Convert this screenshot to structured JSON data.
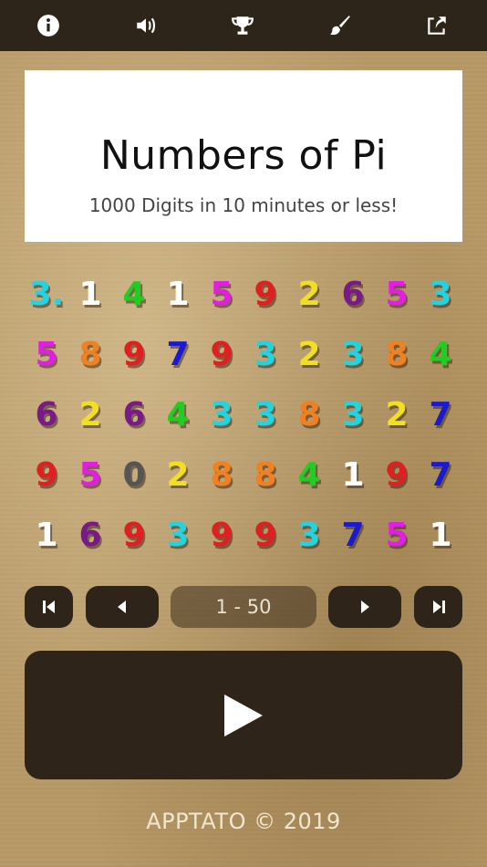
{
  "toolbar": {
    "icons": [
      "info-icon",
      "volume-icon",
      "trophy-icon",
      "brush-icon",
      "share-icon"
    ]
  },
  "header": {
    "title": "Numbers of Pi",
    "subtitle": "1000 Digits in 10 minutes or less!"
  },
  "digits": [
    {
      "text": "3.",
      "color": "#22d3e0"
    },
    {
      "text": "1",
      "color": "#ffffff"
    },
    {
      "text": "4",
      "color": "#22cc22"
    },
    {
      "text": "1",
      "color": "#ffffff"
    },
    {
      "text": "5",
      "color": "#e020e0"
    },
    {
      "text": "9",
      "color": "#e02020"
    },
    {
      "text": "2",
      "color": "#f0e020"
    },
    {
      "text": "6",
      "color": "#7a1a8a"
    },
    {
      "text": "5",
      "color": "#e020e0"
    },
    {
      "text": "3",
      "color": "#22d3e0"
    },
    {
      "text": "5",
      "color": "#e020e0"
    },
    {
      "text": "8",
      "color": "#f08020"
    },
    {
      "text": "9",
      "color": "#e02020"
    },
    {
      "text": "7",
      "color": "#1a1ad0"
    },
    {
      "text": "9",
      "color": "#e02020"
    },
    {
      "text": "3",
      "color": "#22d3e0"
    },
    {
      "text": "2",
      "color": "#f0e020"
    },
    {
      "text": "3",
      "color": "#22d3e0"
    },
    {
      "text": "8",
      "color": "#f08020"
    },
    {
      "text": "4",
      "color": "#22cc22"
    },
    {
      "text": "6",
      "color": "#7a1a8a"
    },
    {
      "text": "2",
      "color": "#f0e020"
    },
    {
      "text": "6",
      "color": "#7a1a8a"
    },
    {
      "text": "4",
      "color": "#22cc22"
    },
    {
      "text": "3",
      "color": "#22d3e0"
    },
    {
      "text": "3",
      "color": "#22d3e0"
    },
    {
      "text": "8",
      "color": "#f08020"
    },
    {
      "text": "3",
      "color": "#22d3e0"
    },
    {
      "text": "2",
      "color": "#f0e020"
    },
    {
      "text": "7",
      "color": "#1a1ad0"
    },
    {
      "text": "9",
      "color": "#e02020"
    },
    {
      "text": "5",
      "color": "#e020e0"
    },
    {
      "text": "0",
      "color": "#555555"
    },
    {
      "text": "2",
      "color": "#f0e020"
    },
    {
      "text": "8",
      "color": "#f08020"
    },
    {
      "text": "8",
      "color": "#f08020"
    },
    {
      "text": "4",
      "color": "#22cc22"
    },
    {
      "text": "1",
      "color": "#ffffff"
    },
    {
      "text": "9",
      "color": "#e02020"
    },
    {
      "text": "7",
      "color": "#1a1ad0"
    },
    {
      "text": "1",
      "color": "#ffffff"
    },
    {
      "text": "6",
      "color": "#7a1a8a"
    },
    {
      "text": "9",
      "color": "#e02020"
    },
    {
      "text": "3",
      "color": "#22d3e0"
    },
    {
      "text": "9",
      "color": "#e02020"
    },
    {
      "text": "9",
      "color": "#e02020"
    },
    {
      "text": "3",
      "color": "#22d3e0"
    },
    {
      "text": "7",
      "color": "#1a1ad0"
    },
    {
      "text": "5",
      "color": "#e020e0"
    },
    {
      "text": "1",
      "color": "#ffffff"
    }
  ],
  "pager": {
    "first_icon": "skip-first-icon",
    "prev_icon": "prev-icon",
    "range_label": "1 - 50",
    "next_icon": "next-icon",
    "last_icon": "skip-last-icon"
  },
  "play": {
    "icon": "play-icon"
  },
  "footer": {
    "text": "APPTATO © 2019"
  },
  "colors": {
    "topbar": "#2d241a",
    "button": "#2e2419",
    "background": "#b89a68"
  }
}
